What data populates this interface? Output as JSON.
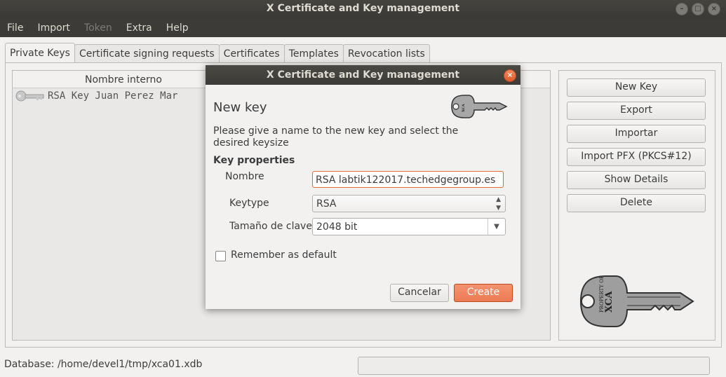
{
  "window": {
    "title": "X Certificate and Key management"
  },
  "menu": [
    "File",
    "Import",
    "Token",
    "Extra",
    "Help"
  ],
  "tabs": [
    "Private Keys",
    "Certificate signing requests",
    "Certificates",
    "Templates",
    "Revocation lists"
  ],
  "keylist": {
    "column_header": "Nombre interno",
    "rows": [
      "RSA Key Juan Perez Mar"
    ]
  },
  "side_buttons": {
    "new_key": "New Key",
    "export": "Export",
    "importar": "Importar",
    "import_pfx": "Import PFX (PKCS#12)",
    "show_details": "Show Details",
    "delete": "Delete"
  },
  "status": {
    "database": "Database: /home/devel1/tmp/xca01.xdb"
  },
  "dialog": {
    "title": "X Certificate and Key management",
    "heading": "New key",
    "description": "Please give a name to the new key and select the desired keysize",
    "group_title": "Key properties",
    "name_label": "Nombre",
    "name_value": "RSA labtik122017.techedgegroup.es",
    "keytype_label": "Keytype",
    "keytype_value": "RSA",
    "keysize_label": "Tamaño de clave",
    "keysize_value": "2048 bit",
    "remember_label": "Remember as default",
    "remember_checked": false,
    "cancel_label": "Cancelar",
    "create_label": "Create"
  },
  "logo_text": [
    "PROPERTY OF",
    "XCA"
  ],
  "colors": {
    "accent": "#ec7b54",
    "titlebar": "#3c3b37",
    "close_button": "#e05a2a"
  }
}
